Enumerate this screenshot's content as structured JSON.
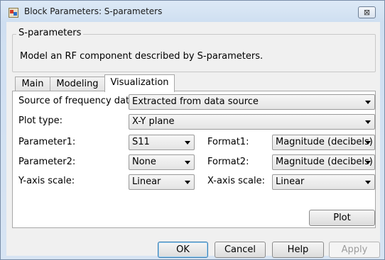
{
  "window": {
    "title": "Block Parameters: S-parameters",
    "close_symbol": "⊠"
  },
  "group": {
    "title": "S-parameters",
    "description": "Model an RF component described by S-parameters."
  },
  "tabs": [
    {
      "label": "Main",
      "active": false
    },
    {
      "label": "Modeling",
      "active": false
    },
    {
      "label": "Visualization",
      "active": true
    }
  ],
  "fields": {
    "source": {
      "label": "Source of frequency data:",
      "value": "Extracted from data source"
    },
    "plot_type": {
      "label": "Plot type:",
      "value": "X-Y plane"
    },
    "parameter1": {
      "label": "Parameter1:",
      "value": "S11"
    },
    "format1": {
      "label": "Format1:",
      "value": "Magnitude (decibels)"
    },
    "parameter2": {
      "label": "Parameter2:",
      "value": "None"
    },
    "format2": {
      "label": "Format2:",
      "value": "Magnitude (decibels)"
    },
    "y_scale": {
      "label": "Y-axis scale:",
      "value": "Linear"
    },
    "x_scale": {
      "label": "X-axis scale:",
      "value": "Linear"
    }
  },
  "buttons": {
    "plot": "Plot",
    "ok": "OK",
    "cancel": "Cancel",
    "help": "Help",
    "apply": "Apply"
  },
  "icons": {
    "app": "simulink-block-icon",
    "close": "close-icon",
    "dropdown": "dropdown-arrow-icon"
  }
}
